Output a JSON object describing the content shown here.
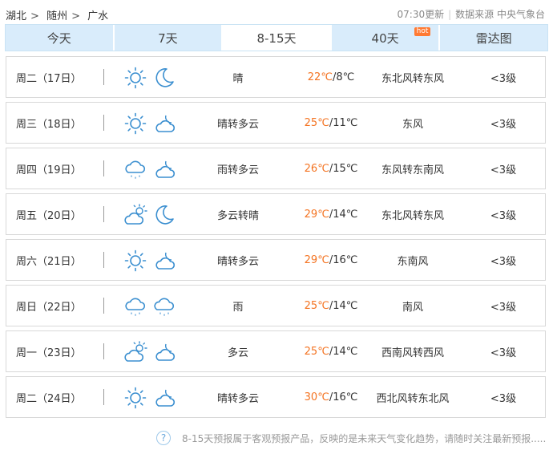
{
  "breadcrumb": {
    "province": "湖北",
    "city": "随州",
    "district": "广水",
    "separator": ">"
  },
  "meta": {
    "updated": "07:30更新",
    "source": "数据来源 中央气象台"
  },
  "tabs": [
    {
      "label": "今天",
      "active": false
    },
    {
      "label": "7天",
      "active": false
    },
    {
      "label": "8-15天",
      "active": true
    },
    {
      "label": "40天",
      "active": false,
      "badge": "hot"
    },
    {
      "label": "雷达图",
      "active": false
    }
  ],
  "colors": {
    "accent": "#3b8fd0",
    "high_temp": "#f47321",
    "tab_bg": "#d9ecfb"
  },
  "days": [
    {
      "date": "周二（17日）",
      "day_icon": "sun-icon",
      "night_icon": "moon-icon",
      "condition": "晴",
      "high": "22℃",
      "low": "/8℃",
      "wind": "东北风转东风",
      "level": "<3级"
    },
    {
      "date": "周三（18日）",
      "day_icon": "sun-icon",
      "night_icon": "cloudy-night-icon",
      "condition": "晴转多云",
      "high": "25℃",
      "low": "/11℃",
      "wind": "东风",
      "level": "<3级"
    },
    {
      "date": "周四（19日）",
      "day_icon": "rain-icon",
      "night_icon": "cloudy-night-icon",
      "condition": "雨转多云",
      "high": "26℃",
      "low": "/15℃",
      "wind": "东风转东南风",
      "level": "<3级"
    },
    {
      "date": "周五（20日）",
      "day_icon": "partly-cloudy-icon",
      "night_icon": "moon-icon",
      "condition": "多云转晴",
      "high": "29℃",
      "low": "/14℃",
      "wind": "东北风转东风",
      "level": "<3级"
    },
    {
      "date": "周六（21日）",
      "day_icon": "sun-icon",
      "night_icon": "cloudy-night-icon",
      "condition": "晴转多云",
      "high": "29℃",
      "low": "/16℃",
      "wind": "东南风",
      "level": "<3级"
    },
    {
      "date": "周日（22日）",
      "day_icon": "rain-icon",
      "night_icon": "rain-icon",
      "condition": "雨",
      "high": "25℃",
      "low": "/14℃",
      "wind": "南风",
      "level": "<3级"
    },
    {
      "date": "周一（23日）",
      "day_icon": "partly-cloudy-icon",
      "night_icon": "cloudy-night-icon",
      "condition": "多云",
      "high": "25℃",
      "low": "/14℃",
      "wind": "西南风转西风",
      "level": "<3级"
    },
    {
      "date": "周二（24日）",
      "day_icon": "sun-icon",
      "night_icon": "cloudy-night-icon",
      "condition": "晴转多云",
      "high": "30℃",
      "low": "/16℃",
      "wind": "西北风转东北风",
      "level": "<3级"
    }
  ],
  "footer": {
    "help_icon": "?",
    "note": "8-15天预报属于客观预报产品，反映的是未来天气变化趋势，请随时关注最新预报....."
  }
}
